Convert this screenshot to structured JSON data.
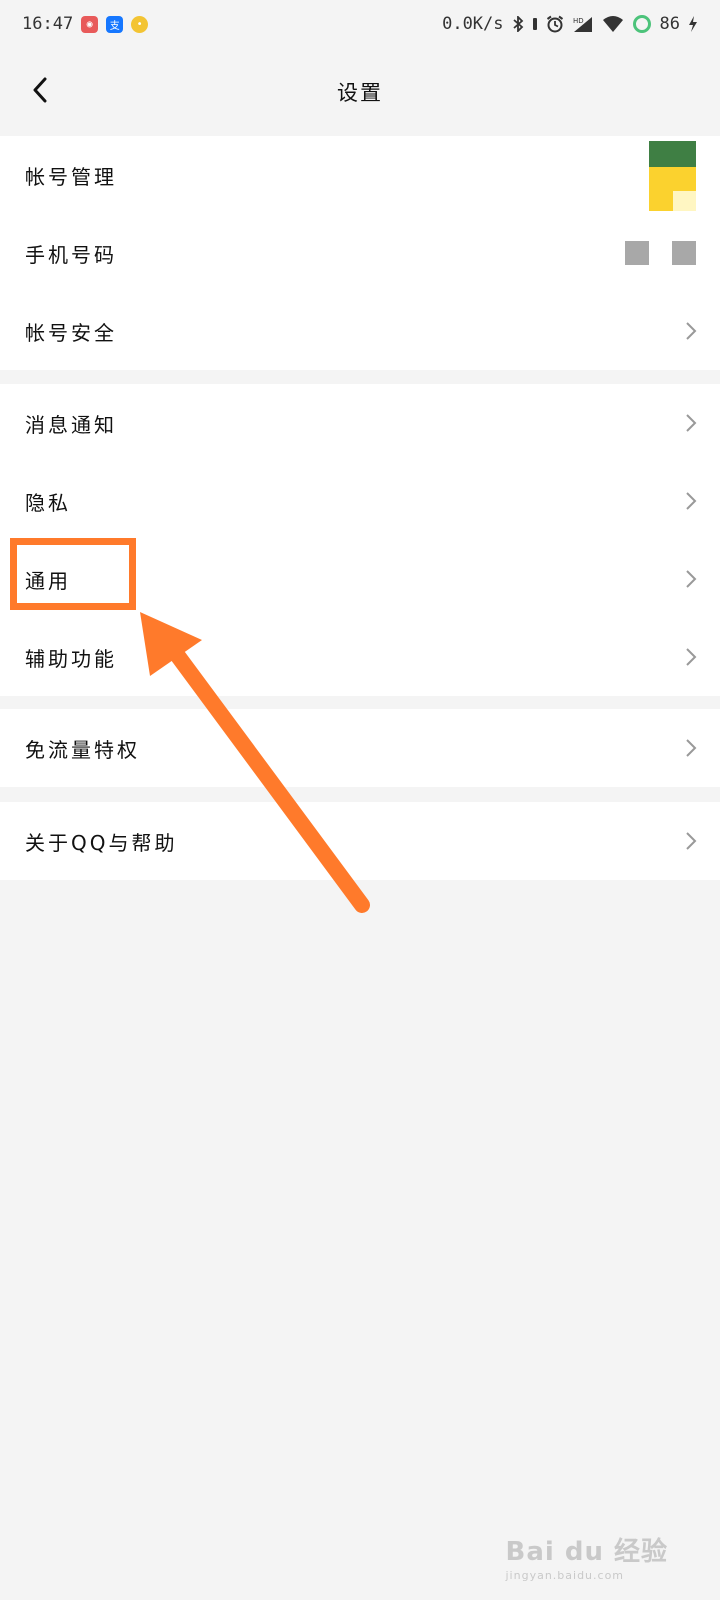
{
  "status_bar": {
    "time": "16:47",
    "net_speed": "0.0K/s",
    "battery": "86",
    "notif_badges": [
      "red-app-badge",
      "alipay-badge",
      "qq-pet-badge"
    ],
    "alipay_glyph": "支"
  },
  "header": {
    "title": "设置",
    "back_icon": "chevron-left-icon"
  },
  "groups": [
    {
      "items": [
        {
          "label": "帐号管理",
          "accessory": "avatar-thumbnail"
        },
        {
          "label": "手机号码",
          "accessory": "masked-phone"
        },
        {
          "label": "帐号安全",
          "accessory": "chevron-right-icon"
        }
      ]
    },
    {
      "items": [
        {
          "label": "消息通知",
          "accessory": "chevron-right-icon"
        },
        {
          "label": "隐私",
          "accessory": "chevron-right-icon"
        },
        {
          "label": "通用",
          "accessory": "chevron-right-icon"
        },
        {
          "label": "辅助功能",
          "accessory": "chevron-right-icon"
        }
      ]
    },
    {
      "items": [
        {
          "label": "免流量特权",
          "accessory": "chevron-right-icon"
        }
      ]
    },
    {
      "items": [
        {
          "label": "关于QQ与帮助",
          "accessory": "chevron-right-icon"
        }
      ]
    }
  ],
  "annotation": {
    "highlight_color": "#ff7a2b",
    "target_item": "通用"
  },
  "watermark": {
    "logo": "Bai du 经验",
    "url": "jingyan.baidu.com"
  }
}
